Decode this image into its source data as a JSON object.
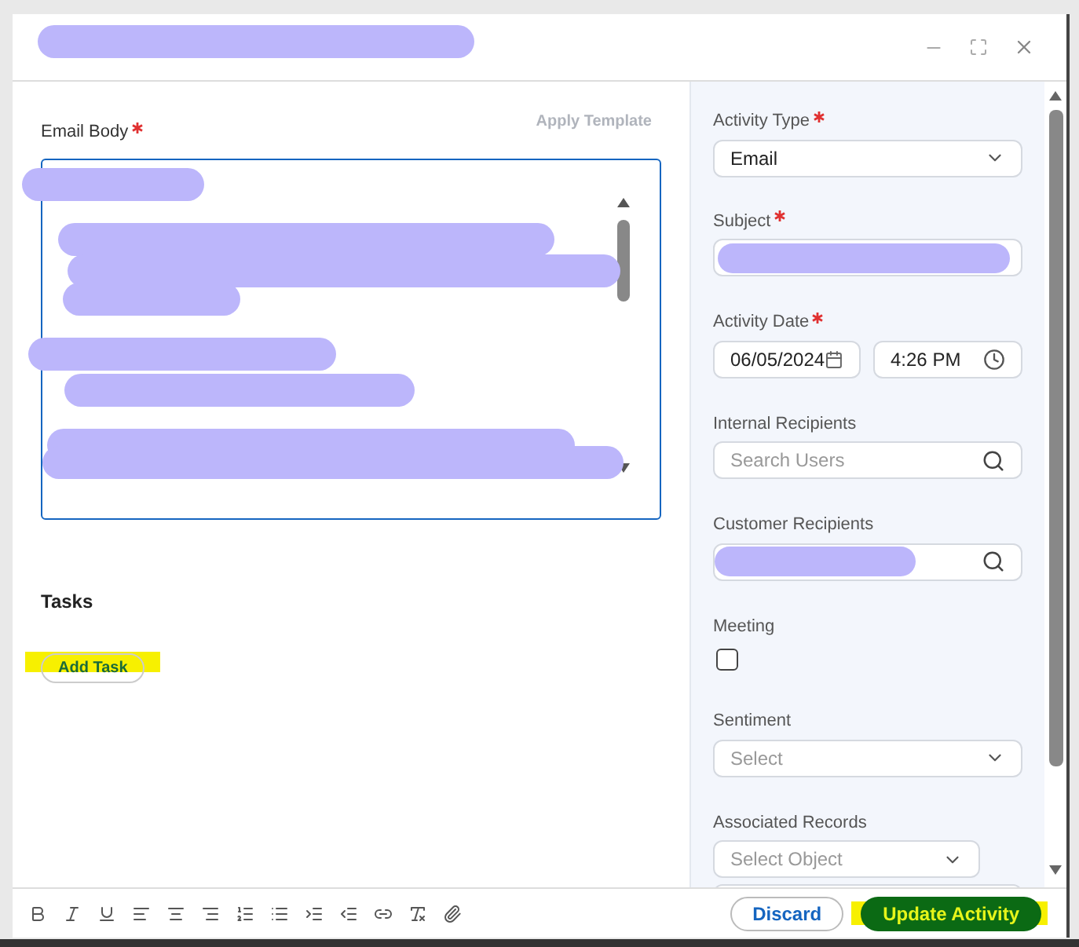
{
  "email_body": {
    "label": "Email Body",
    "required": true,
    "apply_template": "Apply Template"
  },
  "tasks": {
    "heading": "Tasks",
    "add_button": "Add Task"
  },
  "fields": [
    {
      "kind": "select",
      "label": "Activity Type",
      "required": true,
      "value": "Email"
    },
    {
      "kind": "text",
      "label": "Subject",
      "required": true
    },
    {
      "kind": "datetime",
      "label": "Activity Date",
      "required": true,
      "date": "06/05/2024",
      "time": "4:26 PM"
    },
    {
      "kind": "search",
      "label": "Internal Recipients",
      "placeholder": "Search Users"
    },
    {
      "kind": "search",
      "label": "Customer Recipients"
    },
    {
      "kind": "checkbox",
      "label": "Meeting",
      "checked": false
    },
    {
      "kind": "select",
      "label": "Sentiment",
      "placeholder": "Select"
    },
    {
      "kind": "records",
      "label": "Associated Records",
      "placeholder": "Select Object"
    }
  ],
  "footer": {
    "discard": "Discard",
    "submit": "Update Activity"
  }
}
